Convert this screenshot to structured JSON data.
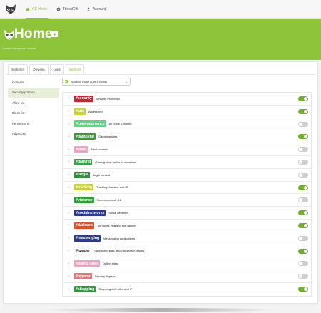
{
  "nav": {
    "items": [
      {
        "label": "CE Home",
        "icon": "house-icon",
        "active": true
      },
      {
        "label": "ThreatDB",
        "icon": "gear-icon",
        "active": false
      },
      {
        "label": "Account",
        "icon": "person-icon",
        "active": false
      }
    ]
  },
  "hero": {
    "title": "Home",
    "subtitle": "Domain management console"
  },
  "tabs": [
    {
      "label": "Statistics",
      "active": false
    },
    {
      "label": "Devices",
      "active": false
    },
    {
      "label": "Logs",
      "active": false
    },
    {
      "label": "Settings",
      "active": true
    }
  ],
  "sidebar": {
    "items": [
      {
        "label": "General",
        "active": false
      },
      {
        "label": "Security policies",
        "active": true
      },
      {
        "label": "Allow list",
        "active": false
      },
      {
        "label": "Block list",
        "active": false
      },
      {
        "label": "Permissions",
        "active": false
      },
      {
        "label": "Advanced",
        "active": false
      }
    ]
  },
  "blocking_mode": {
    "label": "Blocking mode (Log & block)",
    "checked": true
  },
  "rules": [
    {
      "tag": "#security",
      "desc": "Security Protection",
      "color": "#c0282f",
      "enabled": true
    },
    {
      "tag": "#ads",
      "desc": "Advertising",
      "color": "#c9d23a",
      "enabled": true
    },
    {
      "tag": "#cryptocurrency",
      "desc": "All pools & mining",
      "color": "#5fd57e",
      "enabled": false
    },
    {
      "tag": "#gambling",
      "desc": "Gambling sites",
      "color": "#3a9a35",
      "enabled": true
    },
    {
      "tag": "#adult",
      "desc": "Adult content",
      "color": "#f2a3c4",
      "enabled": false
    },
    {
      "tag": "#gaming",
      "desc": "Gaming sites online or download",
      "color": "#3aa349",
      "enabled": false
    },
    {
      "tag": "#illegal",
      "desc": "Illegal content",
      "color": "#2f8f3a",
      "enabled": false
    },
    {
      "tag": "#tracking",
      "desc": "Tracking domains and IP",
      "color": "#c7cf3e",
      "enabled": true
    },
    {
      "tag": "#violence",
      "desc": "Violent content +16",
      "color": "#2f9a3a",
      "enabled": false
    },
    {
      "tag": "#socialnetworks",
      "desc": "Social networks",
      "color": "#2a3a8f",
      "enabled": true
    },
    {
      "tag": "#darkweb",
      "desc": "Tor nodes enabling the darknet",
      "color": "#e0502d",
      "enabled": true
    },
    {
      "tag": "#messenging",
      "desc": "Messenging applications",
      "color": "#2d3a88",
      "enabled": false
    },
    {
      "tag": "#jumper",
      "desc": "Sponsored links at top of search results",
      "color": "#ffffff",
      "textColor": "#222222",
      "enabled": true
    },
    {
      "tag": "#dating-sites",
      "desc": "Dating sites",
      "color": "#f0a0c0",
      "enabled": false
    },
    {
      "tag": "#bypass",
      "desc": "Security Bypass",
      "color": "#e8737a",
      "enabled": false
    },
    {
      "tag": "#shopping",
      "desc": "Shopping web sites and IP",
      "color": "#2f9a3a",
      "enabled": true
    }
  ]
}
